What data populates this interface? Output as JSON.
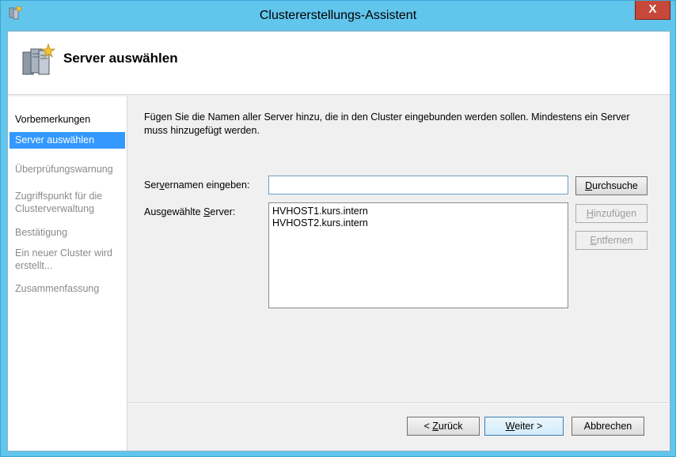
{
  "window": {
    "title": "Clustererstellungs-Assistent",
    "close_label": "X"
  },
  "header": {
    "title": "Server auswählen"
  },
  "nav": {
    "items": [
      {
        "label": "Vorbemerkungen"
      },
      {
        "label": "Server auswählen"
      },
      {
        "label": "Überprüfungswarnung"
      },
      {
        "label": "Zugriffspunkt für die Clusterverwaltung"
      },
      {
        "label": "Bestätigung"
      },
      {
        "label": "Ein neuer Cluster wird erstellt..."
      },
      {
        "label": "Zusammenfassung"
      }
    ]
  },
  "main": {
    "description": "Fügen Sie die Namen aller Server hinzu, die in den Cluster eingebunden werden sollen. Mindestens ein Server muss hinzugefügt werden.",
    "server_name_label_pre": "Ser",
    "server_name_label_key": "v",
    "server_name_label_post": "ernamen eingeben:",
    "server_name_value": "",
    "browse_pre": "",
    "browse_key": "D",
    "browse_post": "urchsuche",
    "selected_label_pre": "Ausgewählte ",
    "selected_label_key": "S",
    "selected_label_post": "erver:",
    "selected_servers": [
      "HVHOST1.kurs.intern",
      "HVHOST2.kurs.intern"
    ],
    "add_pre": "",
    "add_key": "H",
    "add_post": "inzufügen",
    "remove_pre": "",
    "remove_key": "E",
    "remove_post": "ntfernen"
  },
  "footer": {
    "back_pre": "< ",
    "back_key": "Z",
    "back_post": "urück",
    "next_pre": "",
    "next_key": "W",
    "next_post": "eiter >",
    "cancel_label": "Abbrechen"
  }
}
